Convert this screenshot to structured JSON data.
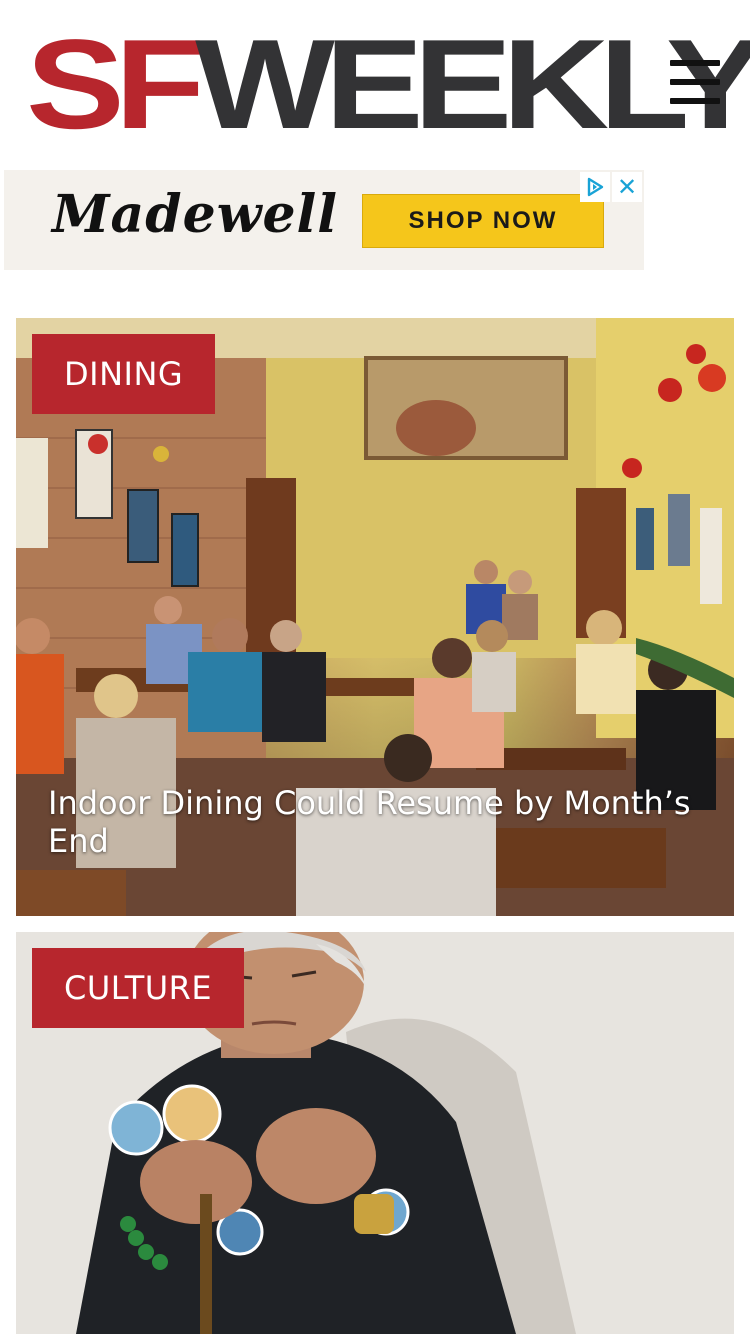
{
  "header": {
    "logo_part1": "SF",
    "logo_part2": "WEEKLY",
    "menu_icon": "hamburger-menu-icon"
  },
  "ad": {
    "brand": "Madewell",
    "cta": "SHOP NOW",
    "choices_icon": "adchoices-icon",
    "close_icon": "close-icon",
    "close_glyph": "✕"
  },
  "articles": [
    {
      "category": "DINING",
      "headline": "Indoor Dining Could Resume by Month’s End",
      "image_icon": "restaurant-photo"
    },
    {
      "category": "CULTURE",
      "headline": "",
      "image_icon": "portrait-photo"
    }
  ],
  "colors": {
    "brand_red": "#b7262d",
    "logo_dark": "#333335",
    "ad_background": "#f4f1ec",
    "cta_yellow": "#f5c61b",
    "adchoices_blue": "#19a3d6"
  }
}
